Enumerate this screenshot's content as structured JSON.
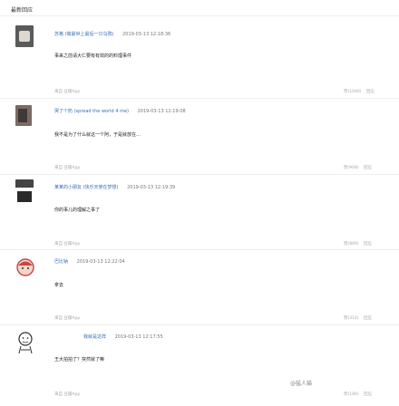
{
  "header": {
    "title": "最新回应"
  },
  "comments": [
    {
      "name": "苏格 (做最世上最后一只乌鸦)",
      "time": "2019-03-13 12:18:36",
      "text": "事来之前请大仁要有有效的的料理事件",
      "source": "来自 豆瓣App",
      "likes": "赞(1040)",
      "reply": "回应"
    },
    {
      "name": "哭了个奶 (spread the world 4 me)",
      "time": "2019-03-13 12:19:08",
      "text": "我不是为了什么就这一个阿，于是就放在…",
      "source": "来自 豆瓣App",
      "likes": "赞(908)",
      "reply": "回应"
    },
    {
      "name": "某某的小朋友 (快乐天使在梦想)",
      "time": "2019-03-13 12:19:39",
      "text": "你的事儿的理解之事了",
      "source": "来自 豆瓣App",
      "likes": "赞(889)",
      "reply": "回应"
    },
    {
      "name": "巴比钠",
      "time": "2019-03-13 12:22:04",
      "text": "拿去",
      "source": "来自 豆瓣App",
      "likes": "赞(314)",
      "reply": "回应"
    },
    {
      "name": "我就是这样",
      "time": "2019-03-13 12:17:55",
      "text": "王大拍拍了？突然就了嘛",
      "source": "来自 豆瓣App",
      "likes": "赞(186)",
      "reply": "回应"
    }
  ],
  "watermark": "@猛人猫",
  "colors": {
    "link": "#3b6fb6",
    "muted": "#aaaaaa",
    "divider": "#eeeeee"
  }
}
